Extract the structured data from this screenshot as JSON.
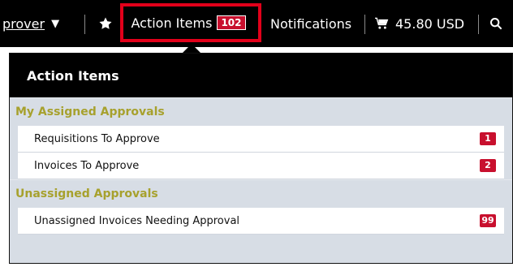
{
  "topbar": {
    "approver_label": "prover",
    "action_items_label": "Action Items",
    "action_items_count": "102",
    "notifications_label": "Notifications",
    "cart_total": "45.80 USD"
  },
  "panel": {
    "title": "Action Items",
    "sections": [
      {
        "title": "My Assigned Approvals",
        "items": [
          {
            "label": "Requisitions To Approve",
            "count": "1"
          },
          {
            "label": "Invoices To Approve",
            "count": "2"
          }
        ]
      },
      {
        "title": "Unassigned Approvals",
        "items": [
          {
            "label": "Unassigned Invoices Needing Approval",
            "count": "99"
          }
        ]
      }
    ]
  },
  "colors": {
    "badge": "#c8102e",
    "highlight_border": "#e2001a",
    "section_title": "#a7a12d",
    "topbar": "#000000"
  }
}
